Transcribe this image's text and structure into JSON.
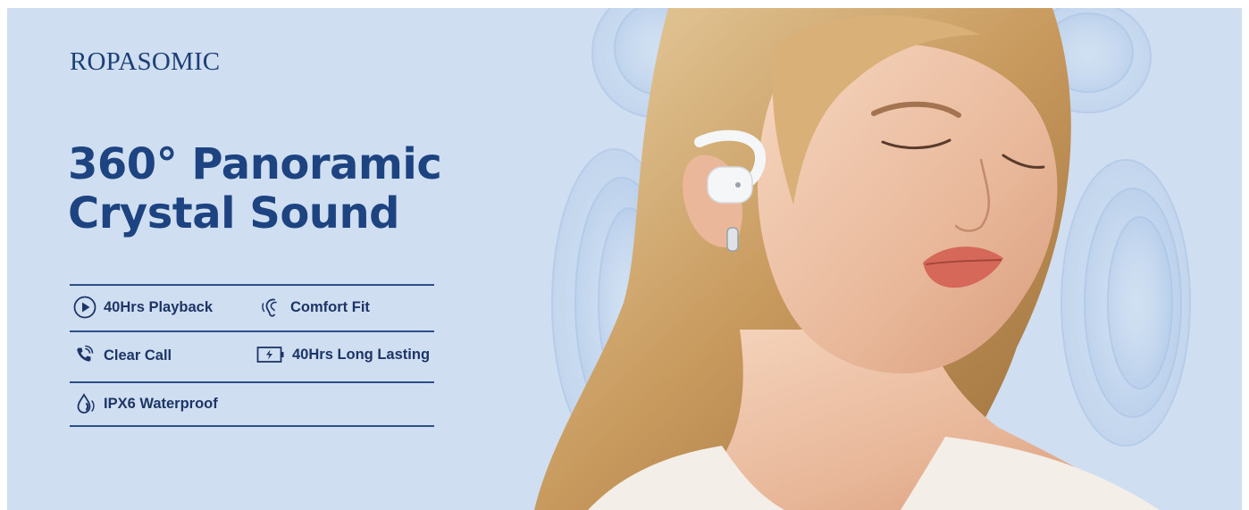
{
  "brand": "ROPASOMIC",
  "headline": {
    "line1": "360° Panoramic",
    "line2": "Crystal Sound"
  },
  "features": [
    {
      "label": "40Hrs Playback",
      "icon": "play-circle-icon"
    },
    {
      "label": "Comfort Fit",
      "icon": "ear-icon"
    },
    {
      "label": "Clear Call",
      "icon": "phone-call-icon"
    },
    {
      "label": "40Hrs Long Lasting",
      "icon": "battery-charge-icon"
    },
    {
      "label": "IPX6 Waterproof",
      "icon": "water-drop-icon"
    }
  ],
  "colors": {
    "background": "#cfdff1",
    "headline": "#1d4480",
    "feature_text": "#1d3566",
    "rule": "#2c4f86"
  },
  "hero_image": "woman-wearing-open-ear-earbud"
}
